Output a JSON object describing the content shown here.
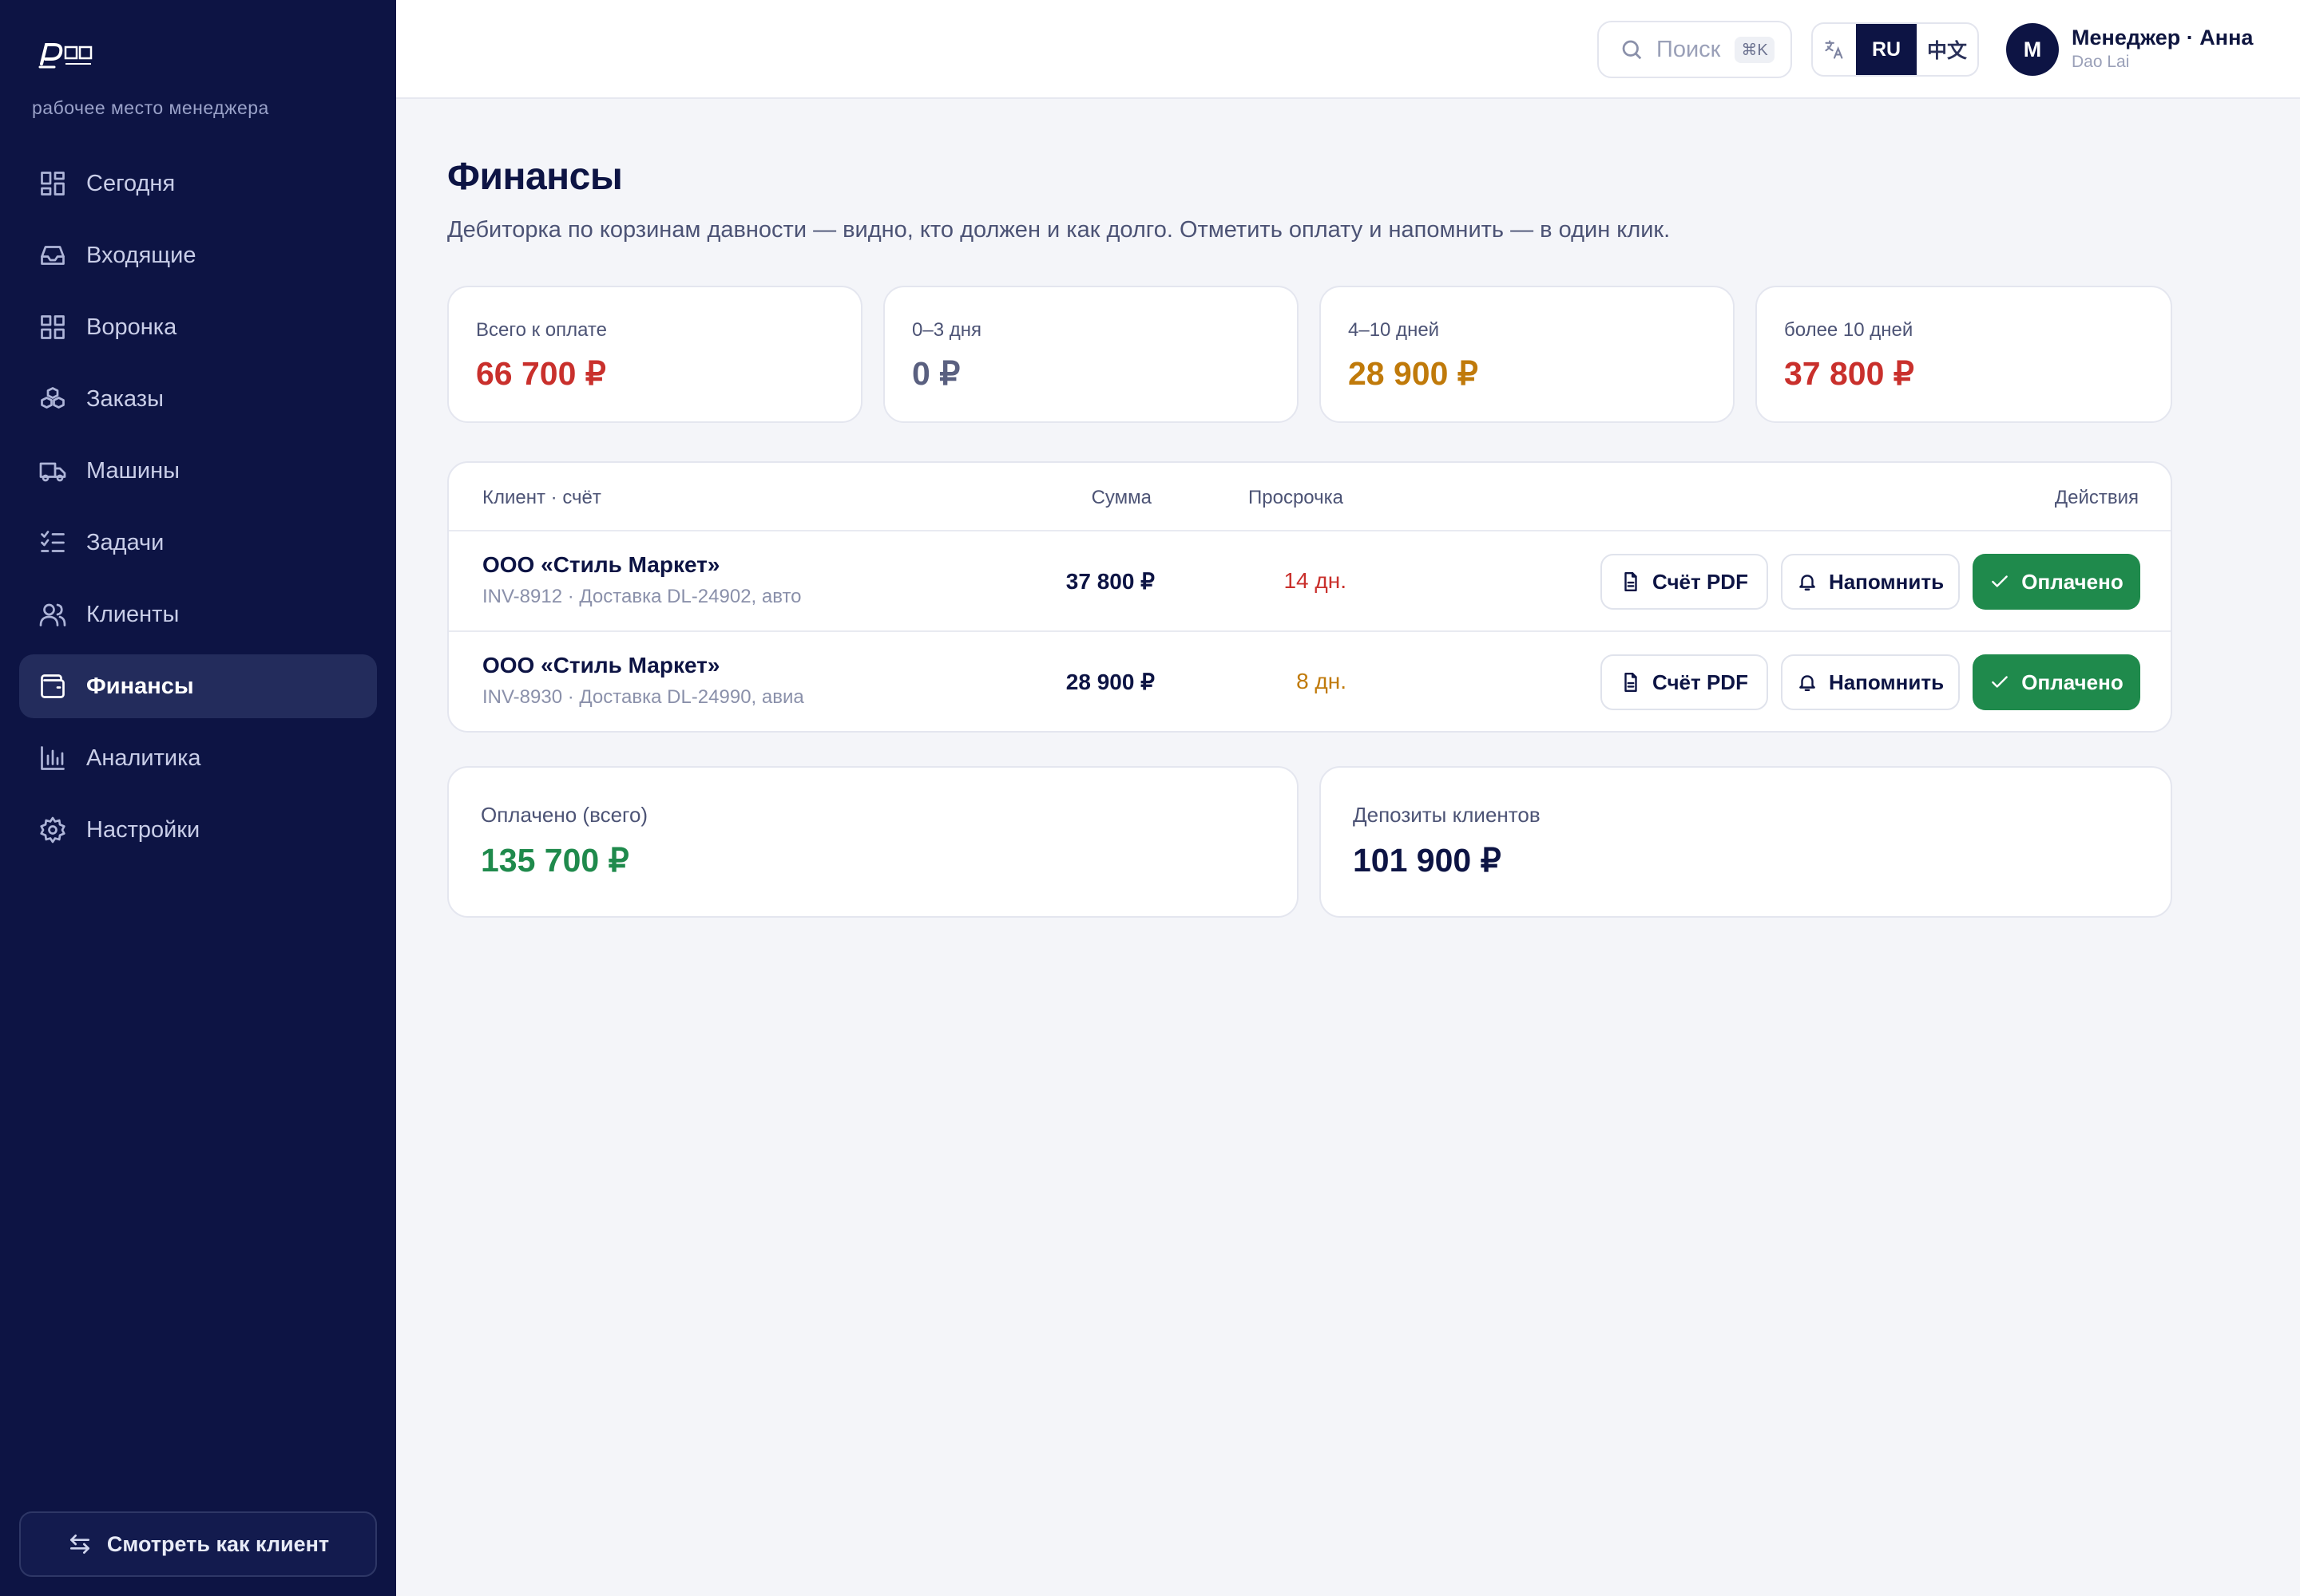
{
  "brand": {
    "name": "DAO LAI",
    "mark": "道莱"
  },
  "sidebar": {
    "subtitle": "рабочее место менеджера",
    "items": [
      {
        "label": "Сегодня",
        "icon": "grid-icon"
      },
      {
        "label": "Входящие",
        "icon": "inbox-icon"
      },
      {
        "label": "Воронка",
        "icon": "funnel-grid-icon"
      },
      {
        "label": "Заказы",
        "icon": "boxes-icon"
      },
      {
        "label": "Машины",
        "icon": "truck-icon"
      },
      {
        "label": "Задачи",
        "icon": "checklist-icon"
      },
      {
        "label": "Клиенты",
        "icon": "users-icon"
      },
      {
        "label": "Финансы",
        "icon": "wallet-icon",
        "active": true
      },
      {
        "label": "Аналитика",
        "icon": "bar-chart-icon"
      },
      {
        "label": "Настройки",
        "icon": "gear-icon"
      }
    ],
    "client_view_label": "Смотреть как клиент"
  },
  "header": {
    "search_placeholder": "Поиск",
    "search_shortcut": "⌘K",
    "lang_options": [
      "RU",
      "中文"
    ],
    "lang_selected": "RU",
    "user_initial": "М",
    "user_name": "Менеджер · Анна",
    "user_company": "Dao Lai"
  },
  "page": {
    "title": "Финансы",
    "description": "Дебиторка по корзинам давности — видно, кто должен и как долго. Отметить оплату и напомнить — в один клик."
  },
  "aging": [
    {
      "label": "Всего к оплате",
      "value": "66 700 ₽",
      "color": "#c9302c"
    },
    {
      "label": "0–3 дня",
      "value": "0 ₽",
      "color": "#5a6080"
    },
    {
      "label": "4–10 дней",
      "value": "28 900 ₽",
      "color": "#c07a0a"
    },
    {
      "label": "более 10 дней",
      "value": "37 800 ₽",
      "color": "#c9302c"
    }
  ],
  "table": {
    "columns": {
      "client": "Клиент · счёт",
      "sum": "Сумма",
      "overdue": "Просрочка",
      "actions": "Действия"
    },
    "rows": [
      {
        "client": "ООО «Стиль Маркет»",
        "invoice": "INV-8912 · Доставка DL-24902, авто",
        "sum": "37 800 ₽",
        "overdue": "14 дн.",
        "overdue_color": "#c9302c"
      },
      {
        "client": "ООО «Стиль Маркет»",
        "invoice": "INV-8930 · Доставка DL-24990, авиа",
        "sum": "28 900 ₽",
        "overdue": "8 дн.",
        "overdue_color": "#c07a0a"
      }
    ],
    "actions": {
      "pdf": "Счёт PDF",
      "remind": "Напомнить",
      "paid": "Оплачено"
    }
  },
  "totals": {
    "paid_label": "Оплачено (всего)",
    "paid_value": "135 700 ₽",
    "deposits_label": "Депозиты клиентов",
    "deposits_value": "101 900 ₽"
  }
}
